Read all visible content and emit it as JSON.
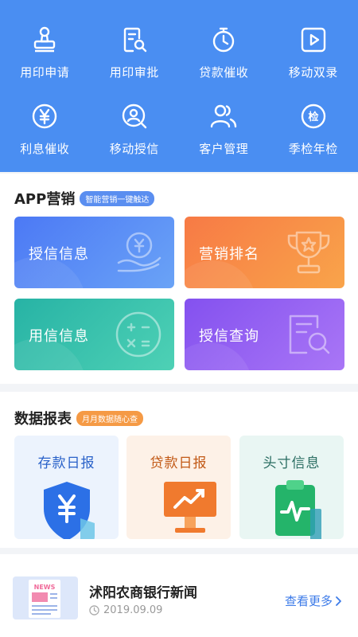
{
  "quick_grid": [
    {
      "label": "用印申请",
      "icon": "stamp-icon"
    },
    {
      "label": "用印审批",
      "icon": "document-search-icon"
    },
    {
      "label": "贷款催收",
      "icon": "stopwatch-icon"
    },
    {
      "label": "移动双录",
      "icon": "video-play-icon"
    },
    {
      "label": "利息催收",
      "icon": "yen-circle-icon"
    },
    {
      "label": "移动授信",
      "icon": "person-search-icon"
    },
    {
      "label": "客户管理",
      "icon": "users-icon"
    },
    {
      "label": "季检年检",
      "icon": "inspect-badge-icon"
    }
  ],
  "marketing": {
    "title": "APP营销",
    "tag": "智能营销一键触达",
    "cards": [
      {
        "label": "授信信息",
        "icon": "hand-yen-icon"
      },
      {
        "label": "营销排名",
        "icon": "trophy-icon"
      },
      {
        "label": "用信信息",
        "icon": "calculator-icon"
      },
      {
        "label": "授信查询",
        "icon": "document-search-icon"
      }
    ]
  },
  "reports": {
    "title": "数据报表",
    "tag": "月月数据随心查",
    "cards": [
      {
        "label": "存款日报",
        "icon": "shield-yen-icon"
      },
      {
        "label": "贷款日报",
        "icon": "monitor-trend-icon"
      },
      {
        "label": "头寸信息",
        "icon": "clipboard-pulse-icon"
      }
    ]
  },
  "news": {
    "thumb_text": "NEWS",
    "title": "沭阳农商银行新闻",
    "date": "2019.09.09",
    "more_label": "查看更多"
  },
  "colors": {
    "header_blue": "#4a8ef2",
    "link_blue": "#3b7ae8",
    "tag_blue": "#5a8ef0",
    "tag_orange": "#f59a45"
  }
}
